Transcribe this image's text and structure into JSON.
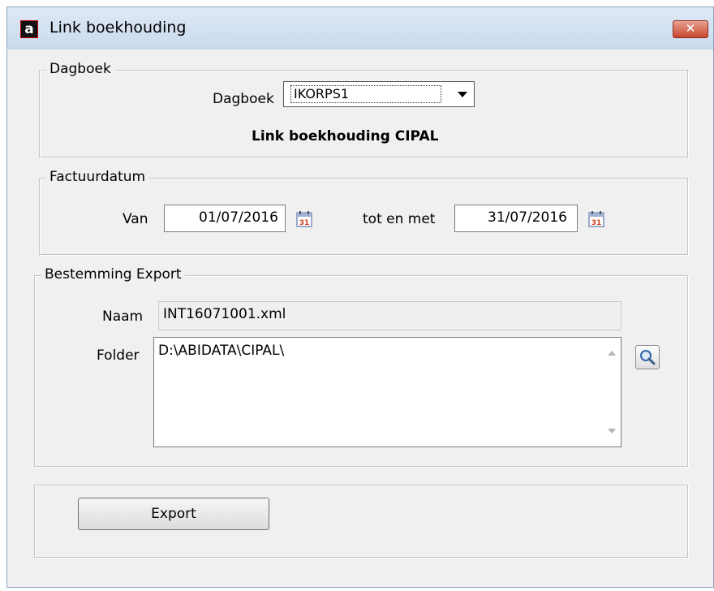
{
  "window": {
    "title": "Link boekhouding",
    "logo_letter": "a",
    "close_glyph": "✕"
  },
  "dagboek_group": {
    "legend": "Dagboek",
    "label": "Dagboek",
    "selected": "IKORPS1",
    "description": "Link boekhouding CIPAL"
  },
  "factuurdatum_group": {
    "legend": "Factuurdatum",
    "van_label": "Van",
    "van_value": "01/07/2016",
    "tot_label": "tot en met",
    "tot_value": "31/07/2016",
    "calendar_day": "31"
  },
  "bestemming_group": {
    "legend": "Bestemming Export",
    "naam_label": "Naam",
    "naam_value": "INT16071001.xml",
    "folder_label": "Folder",
    "folder_value": "D:\\ABIDATA\\CIPAL\\"
  },
  "actions": {
    "export_label": "Export"
  },
  "icons": [
    "calendar-icon",
    "search-icon",
    "dropdown-arrow-icon",
    "close-icon"
  ]
}
